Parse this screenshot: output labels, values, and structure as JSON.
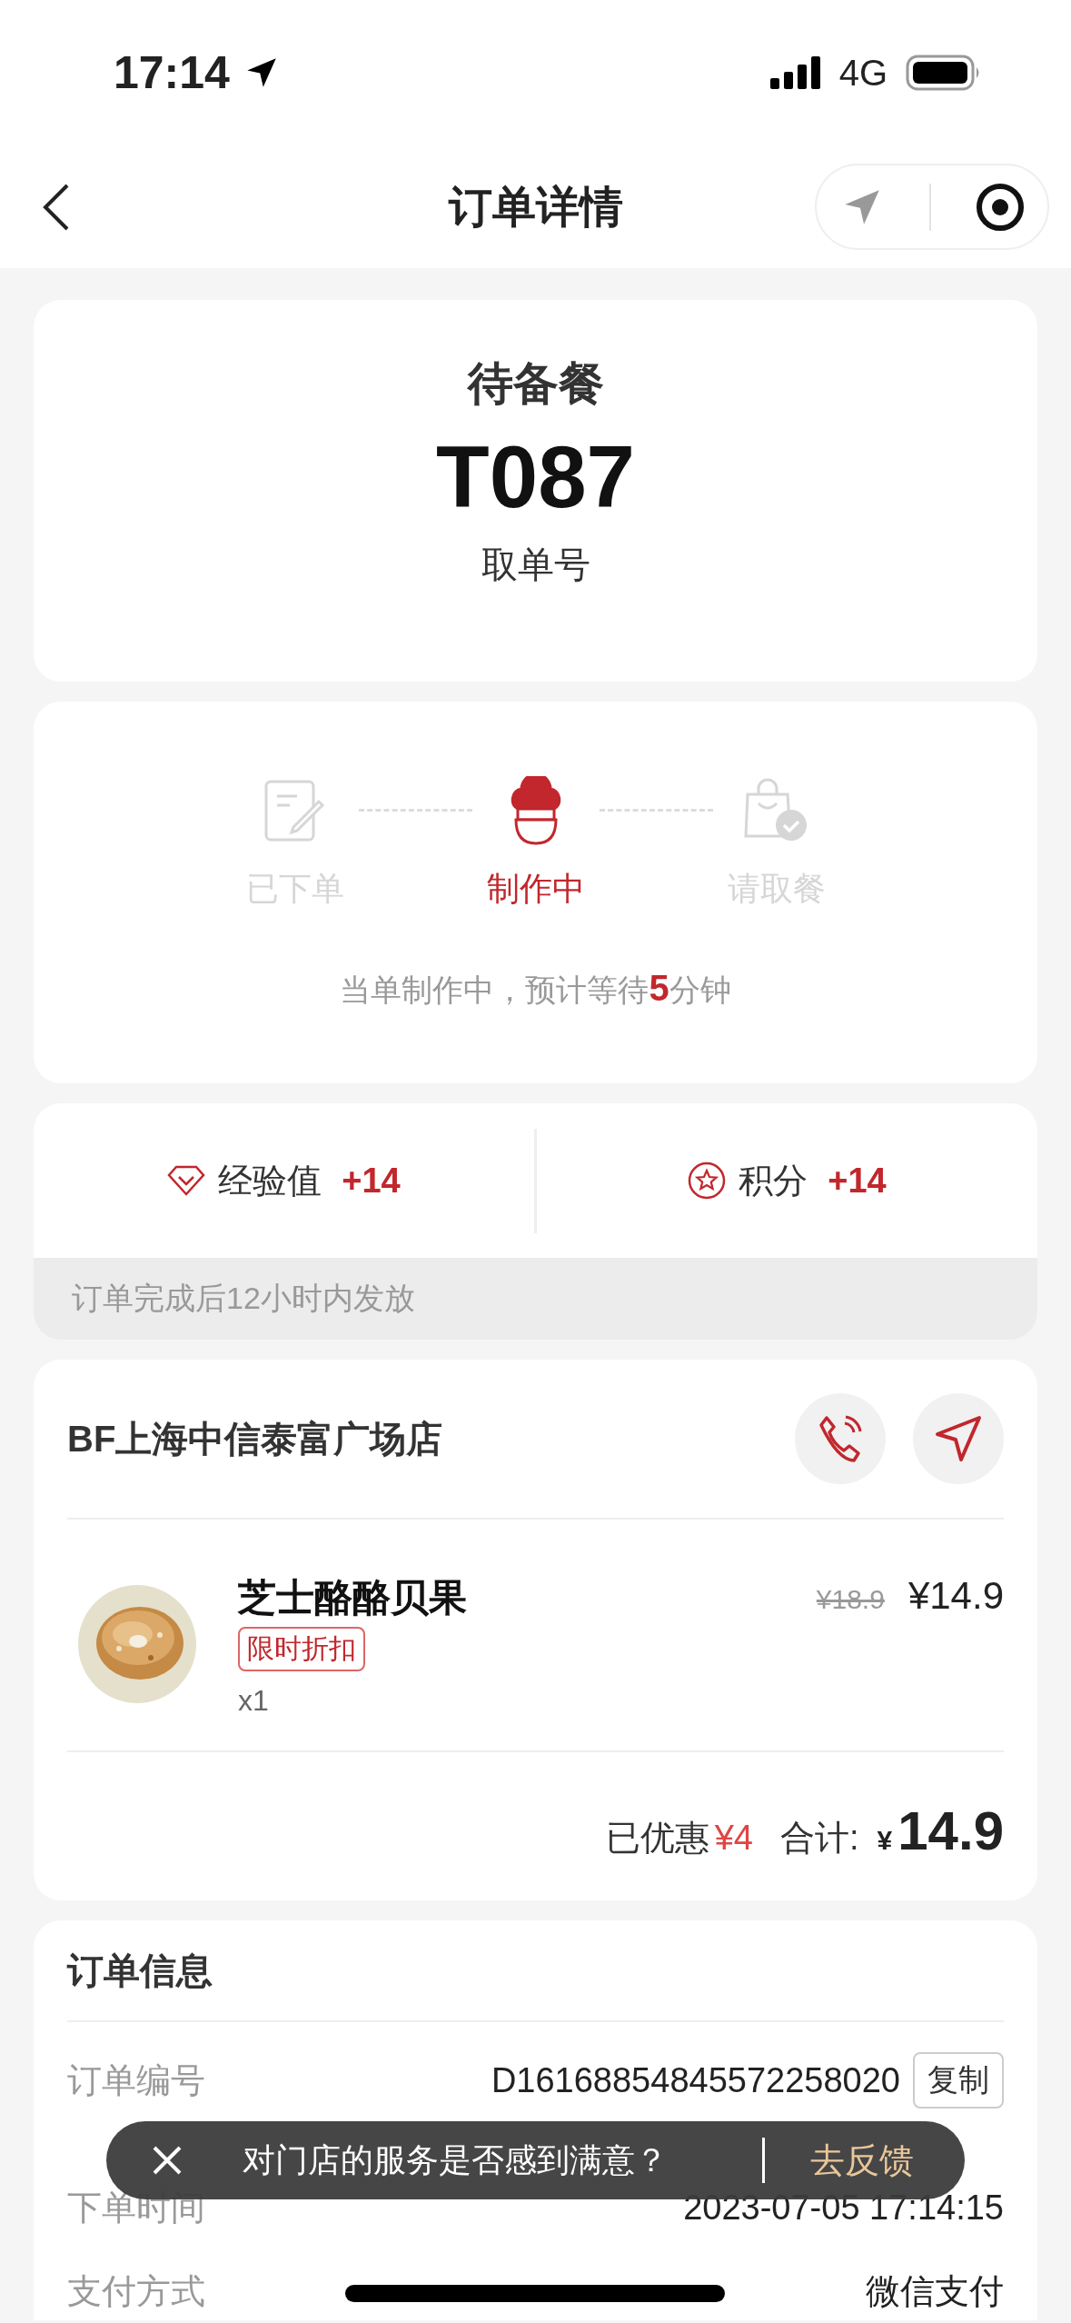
{
  "status_bar": {
    "time": "17:14",
    "network": "4G"
  },
  "nav": {
    "title": "订单详情"
  },
  "pickup": {
    "status": "待备餐",
    "code": "T087",
    "label": "取单号"
  },
  "progress": {
    "steps": [
      {
        "label": "已下单",
        "kind": "placed",
        "selected": false
      },
      {
        "label": "制作中",
        "kind": "cooking",
        "selected": true
      },
      {
        "label": "请取餐",
        "kind": "pickup",
        "selected": false
      }
    ],
    "message": "当单制作中，预计等待**5**分钟"
  },
  "rewards": {
    "items": [
      {
        "kind": "experience",
        "label": "经验值",
        "value": "+14"
      },
      {
        "kind": "points",
        "label": "积分",
        "value": "+14"
      }
    ],
    "note": "订单完成后12小时内发放"
  },
  "store": {
    "name": "BF上海中信泰富广场店",
    "items": [
      {
        "name": "芝士酪酪贝果",
        "tag": "限时折扣",
        "quantity": "x1",
        "original_price": "¥18.9",
        "price": "¥14.9"
      }
    ],
    "discount_label": "已优惠",
    "discount": "¥4",
    "total_label": "合计:",
    "total_currency": "¥",
    "total": "14.9"
  },
  "order_info": {
    "title": "订单信息",
    "rows": [
      {
        "label": "订单编号",
        "value": "D16168854845572258020",
        "action": "复制"
      },
      {
        "label": "下单时间",
        "value": "2023-07-05 17:14:15"
      },
      {
        "label": "支付方式",
        "value": "微信支付"
      }
    ]
  },
  "toast": {
    "message": "对门店的服务是否感到满意？",
    "action": "去反馈"
  }
}
